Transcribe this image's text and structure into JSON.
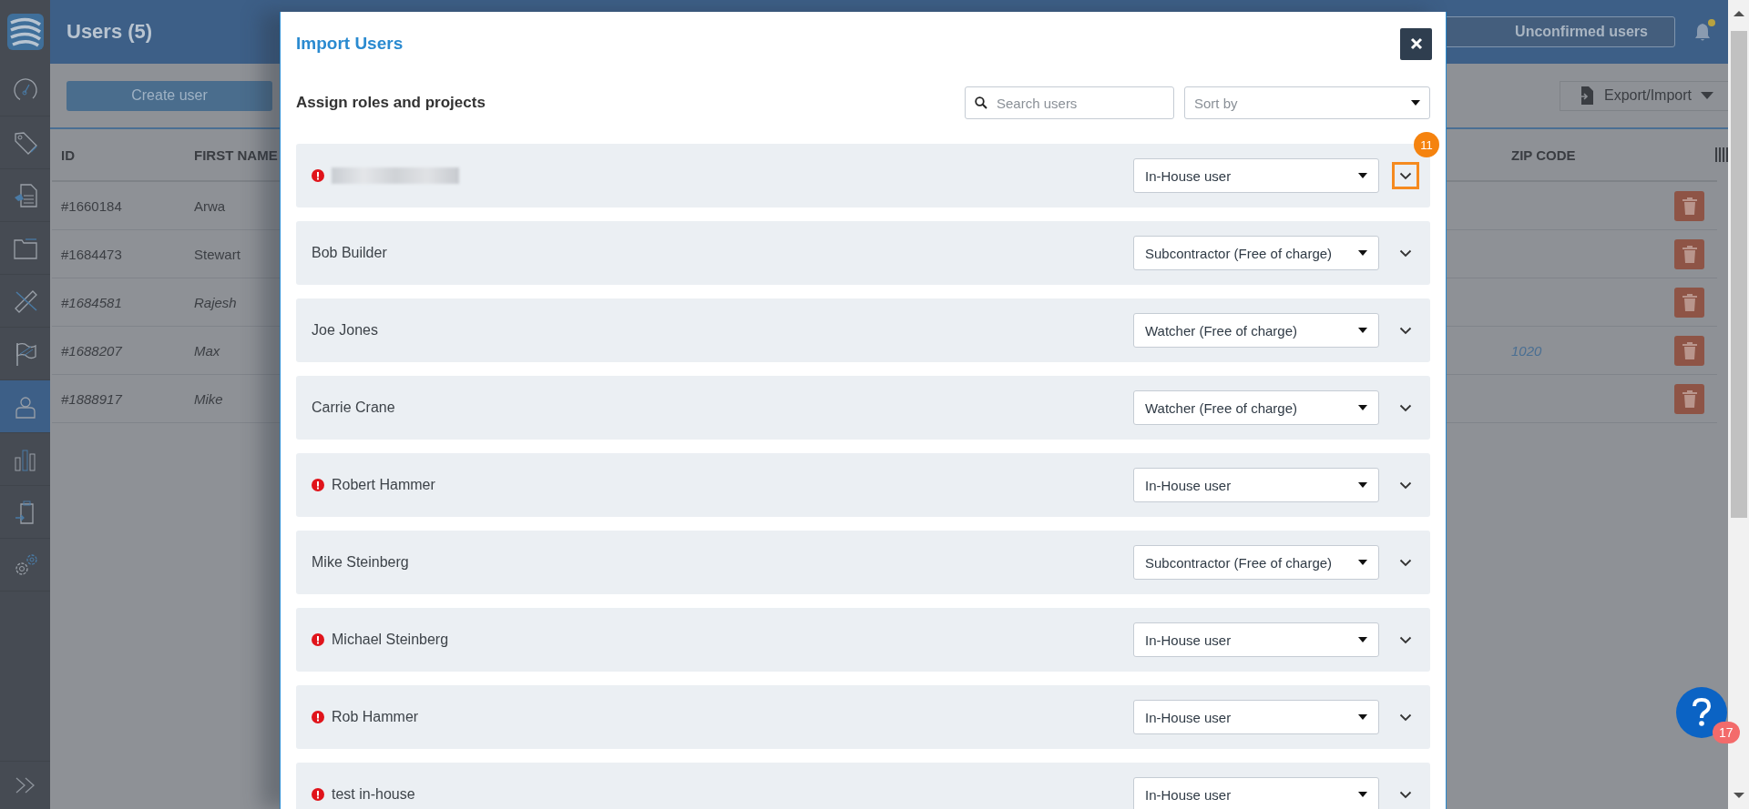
{
  "sidebar": {
    "items": [
      {
        "kind": "gauge",
        "selected": false
      },
      {
        "kind": "tag",
        "selected": false
      },
      {
        "kind": "document",
        "selected": false
      },
      {
        "kind": "folder",
        "selected": false
      },
      {
        "kind": "ruler",
        "selected": false
      },
      {
        "kind": "flag",
        "selected": false
      },
      {
        "kind": "user",
        "selected": true
      },
      {
        "kind": "chart",
        "selected": false
      },
      {
        "kind": "clipboard",
        "selected": false
      },
      {
        "kind": "gears",
        "selected": false
      }
    ]
  },
  "header": {
    "title": "Users (5)",
    "unconfirmed_button": "Unconfirmed users",
    "notification_dot": true
  },
  "toolbar": {
    "create_button": "Create user",
    "export_button": "Export/Import"
  },
  "table": {
    "columns": [
      "ID",
      "FIRST NAME",
      "ZIP CODE"
    ],
    "rows": [
      {
        "id": "#1660184",
        "first_name": "Arwa",
        "italic": false
      },
      {
        "id": "#1684473",
        "first_name": "Stewart",
        "italic": false
      },
      {
        "id": "#1684581",
        "first_name": "Rajesh",
        "italic": true
      },
      {
        "id": "#1688207",
        "first_name": "Max",
        "zip": "1020",
        "italic": true
      },
      {
        "id": "#1888917",
        "first_name": "Mike",
        "italic": true
      }
    ]
  },
  "modal": {
    "title": "Import Users",
    "subtitle": "Assign roles and projects",
    "search": {
      "placeholder": "Search users"
    },
    "sort": {
      "placeholder": "Sort by"
    },
    "users": [
      {
        "blurred": true,
        "error": true,
        "role": "In-House user",
        "highlighted": true,
        "step_badge": "11"
      },
      {
        "name": "Bob Builder",
        "error": false,
        "role": "Subcontractor (Free of charge)",
        "highlighted": false
      },
      {
        "name": "Joe Jones",
        "error": false,
        "role": "Watcher (Free of charge)",
        "highlighted": false
      },
      {
        "name": "Carrie Crane",
        "error": false,
        "role": "Watcher (Free of charge)",
        "highlighted": false
      },
      {
        "name": "Robert Hammer",
        "error": true,
        "role": "In-House user",
        "highlighted": false
      },
      {
        "name": "Mike Steinberg",
        "error": false,
        "role": "Subcontractor (Free of charge)",
        "highlighted": false
      },
      {
        "name": "Michael Steinberg",
        "error": true,
        "role": "In-House user",
        "highlighted": false
      },
      {
        "name": "Rob Hammer",
        "error": true,
        "role": "In-House user",
        "highlighted": false
      },
      {
        "name": "test in-house",
        "error": true,
        "role": "In-House user",
        "highlighted": false
      }
    ]
  },
  "help": {
    "badge": "17"
  }
}
